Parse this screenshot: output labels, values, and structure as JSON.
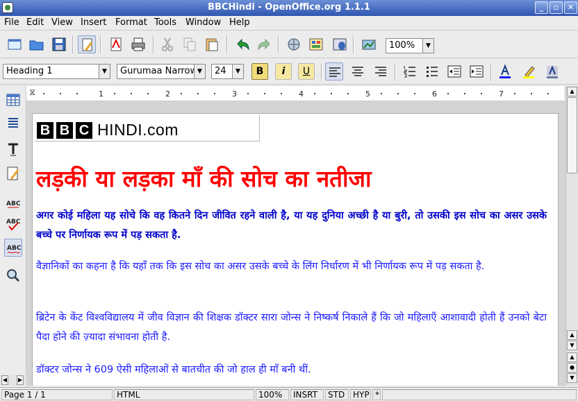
{
  "window": {
    "title": "BBCHindi - OpenOffice.org 1.1.1"
  },
  "menu": [
    "File",
    "Edit",
    "View",
    "Insert",
    "Format",
    "Tools",
    "Window",
    "Help"
  ],
  "toolbar": {
    "zoom": "100%"
  },
  "format": {
    "style": "Heading 1",
    "font": "Gurumaa Narrow",
    "size": "24",
    "bold": "B",
    "italic": "i",
    "underline": "U"
  },
  "ruler": {
    "numbers": [
      "1",
      "2",
      "3",
      "4",
      "5",
      "6",
      "7"
    ]
  },
  "doc": {
    "logo_bbc": [
      "B",
      "B",
      "C"
    ],
    "logo_hindi": "HINDI.com",
    "headline": "लड़की या लड़का माँ की सोच का नतीजा",
    "p1": "अगर कोई महिला यह सोचे कि वह कितने दिन जीवित रहने वाली है, या यह दुनिया अच्छी है या बुरी, तो उसकी इस सोच का असर उसके बच्चे पर निर्णायक रूप में पड़ सकता है.",
    "p2": "वैज्ञानिकों का कहना है कि यहाँ तक कि इस सोच का असर उसके बच्चे के लिंग निर्धारण में भी निर्णायक रूप में पड़ सकता है.",
    "p3": "ब्रिटेन के केंट विश्वविद्यालय में जीव विज्ञान की शिक्षक डॉक्टर सारा जोन्स ने निष्कर्ष निकाले हैं कि जो महिलाएँ आशावादी होती हैं उनको बेटा पैदा होने की ज़्यादा संभावना होती है.",
    "p4": "डॉक्टर जोन्स ने 609 ऐसी महिलाओं से बातचीत की जो हाल ही माँ बनी थीं."
  },
  "status": {
    "page": "Page 1 / 1",
    "mode": "HTML",
    "zoom": "100%",
    "insert": "INSRT",
    "std": "STD",
    "hyp": "HYP",
    "modified": "*"
  }
}
